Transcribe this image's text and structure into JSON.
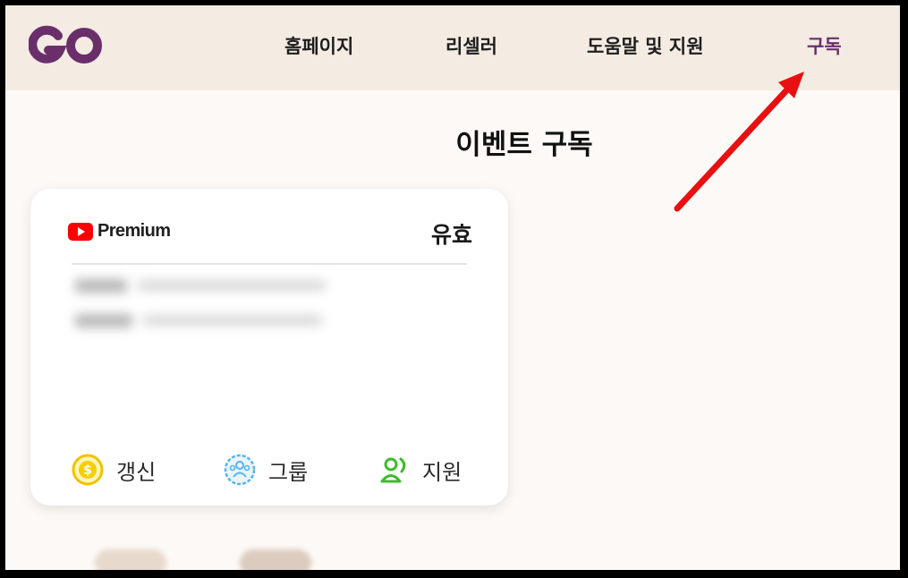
{
  "header": {
    "logo_text": "GO",
    "nav": [
      {
        "label": "홈페이지"
      },
      {
        "label": "리셀러"
      },
      {
        "label": "도움말 및 지원"
      },
      {
        "label": "구독"
      }
    ]
  },
  "main": {
    "title": "이벤트 구독"
  },
  "card": {
    "service_name": "Premium",
    "status": "유효",
    "actions": [
      {
        "label": "갱신",
        "icon": "dollar-coin-icon",
        "color": "#f2c200"
      },
      {
        "label": "그룹",
        "icon": "group-icon",
        "color": "#59b3f0"
      },
      {
        "label": "지원",
        "icon": "support-agent-icon",
        "color": "#3dbb2b"
      }
    ]
  },
  "colors": {
    "brand": "#6a2f6b",
    "header_bg": "#f4ebe3",
    "page_bg": "#fdf9f6",
    "youtube_red": "#ff0000",
    "annotation_arrow": "#e81010"
  }
}
